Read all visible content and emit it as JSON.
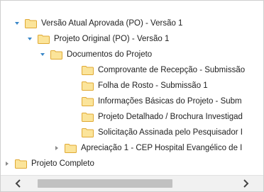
{
  "tree": {
    "nodes": [
      {
        "label": "Versão Atual Aprovada (PO) - Versão 1",
        "state": "expanded"
      },
      {
        "label": "Projeto Original (PO) - Versão 1",
        "state": "expanded"
      },
      {
        "label": "Documentos do Projeto",
        "state": "expanded"
      },
      {
        "label": "Comprovante de Recepção - Submissão",
        "state": "leaf"
      },
      {
        "label": "Folha de Rosto - Submissão 1",
        "state": "leaf"
      },
      {
        "label": "Informações Básicas do Projeto - Subm",
        "state": "leaf"
      },
      {
        "label": "Projeto Detalhado / Brochura Investigad",
        "state": "leaf"
      },
      {
        "label": "Solicitação Assinada pelo Pesquisador I",
        "state": "leaf"
      },
      {
        "label": "Apreciação 1 - CEP Hospital Evangélico de I",
        "state": "collapsed"
      },
      {
        "label": "Projeto Completo",
        "state": "collapsed"
      }
    ]
  },
  "colors": {
    "folder_fill": "#fbe49a",
    "folder_stroke": "#e0a933",
    "toggle_expanded": "#3a87c8",
    "toggle_collapsed": "#8a8a8a",
    "scrollbar_thumb": "#c1c1c1"
  },
  "icons": {
    "expanded_toggle": "triangle-down-icon",
    "collapsed_toggle": "triangle-right-icon",
    "node": "folder-icon",
    "scroll_left": "chevron-left-icon",
    "scroll_right": "chevron-right-icon"
  }
}
